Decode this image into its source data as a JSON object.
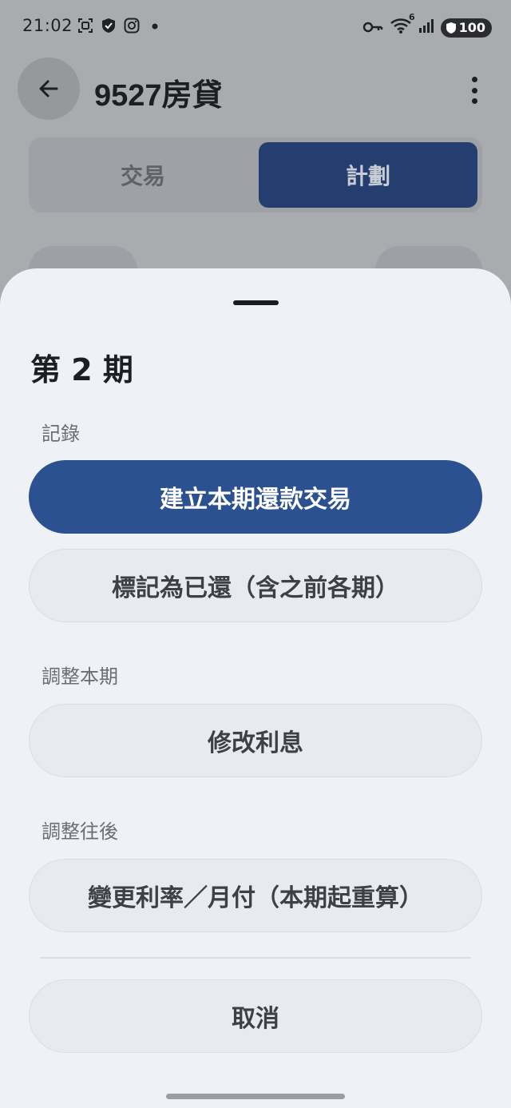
{
  "status_bar": {
    "time": "21:02",
    "left_icons": [
      "screenshot-icon",
      "shield-icon",
      "instagram-icon",
      "dot-icon"
    ],
    "right_icons": [
      "key-icon",
      "wifi-icon",
      "signal-icon"
    ],
    "wifi_badge": "6",
    "battery": "100"
  },
  "app_bar": {
    "title": "9527房貸"
  },
  "tabs": {
    "items": [
      "交易",
      "計劃"
    ],
    "selected": "計劃"
  },
  "sheet": {
    "title": "第 2 期",
    "sections": [
      {
        "label": "記錄",
        "buttons": [
          {
            "label": "建立本期還款交易",
            "style": "primary"
          },
          {
            "label": "標記為已還（含之前各期）",
            "style": "secondary"
          }
        ]
      },
      {
        "label": "調整本期",
        "buttons": [
          {
            "label": "修改利息",
            "style": "secondary"
          }
        ]
      },
      {
        "label": "調整往後",
        "buttons": [
          {
            "label": "變更利率／月付（本期起重算）",
            "style": "secondary"
          }
        ]
      }
    ],
    "cancel_label": "取消"
  },
  "colors": {
    "primary": "#2b5190",
    "sheet_bg": "#eef1f6",
    "scrim": "#a9abaf",
    "tab_selected": "#243f6f"
  }
}
